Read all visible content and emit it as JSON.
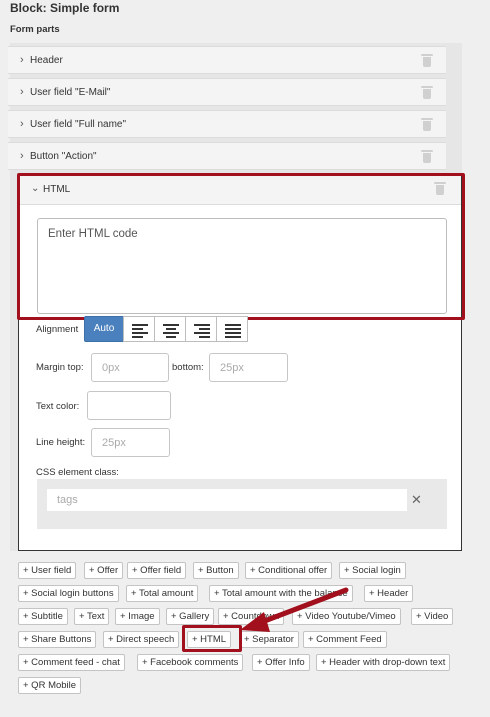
{
  "block": {
    "prefix": "Block:",
    "name": "Simple form"
  },
  "section_label": "Form parts",
  "parts": [
    {
      "label": "Header",
      "expanded": false
    },
    {
      "label": "User field \"E-Mail\"",
      "expanded": false
    },
    {
      "label": "User field \"Full name\"",
      "expanded": false
    },
    {
      "label": "Button \"Action\"",
      "expanded": false
    },
    {
      "label": "HTML",
      "expanded": true
    }
  ],
  "html_part": {
    "textarea_placeholder": "Enter HTML code",
    "alignment_label": "Alignment",
    "alignment_options": [
      {
        "label": "Auto",
        "active": true,
        "icon": "auto"
      },
      {
        "label": "",
        "icon": "align-left-icon"
      },
      {
        "label": "",
        "icon": "align-center-icon"
      },
      {
        "label": "",
        "icon": "align-right-icon"
      },
      {
        "label": "",
        "icon": "align-justify-icon"
      }
    ],
    "margin_top_label": "Margin top:",
    "margin_top_placeholder": "0px",
    "margin_bottom_label": "bottom:",
    "margin_bottom_placeholder": "25px",
    "text_color_label": "Text color:",
    "line_height_label": "Line height:",
    "line_height_placeholder": "25px",
    "css_class_label": "CSS element class:",
    "tags_placeholder": "tags"
  },
  "add_buttons": [
    "+ User field",
    "+ Offer",
    "+ Offer field",
    "+ Button",
    "+ Conditional offer",
    "+ Social login",
    "+ Social login buttons",
    "+ Total amount",
    "+ Total amount with the balance",
    "+ Header",
    "+ Subtitle",
    "+ Text",
    "+ Image",
    "+ Gallery",
    "+ Countdown",
    "+ Video Youtube/Vimeo",
    "+ Video",
    "+ Share Buttons",
    "+ Direct speech",
    "+ HTML",
    "+ Separator",
    "+ Comment Feed",
    "+ Comment feed - chat",
    "+ Facebook comments",
    "+ Offer Info",
    "+ Header with drop-down text",
    "+ QR Mobile"
  ],
  "colors": {
    "highlight": "#a1101c",
    "active_button": "#4a80bd"
  }
}
